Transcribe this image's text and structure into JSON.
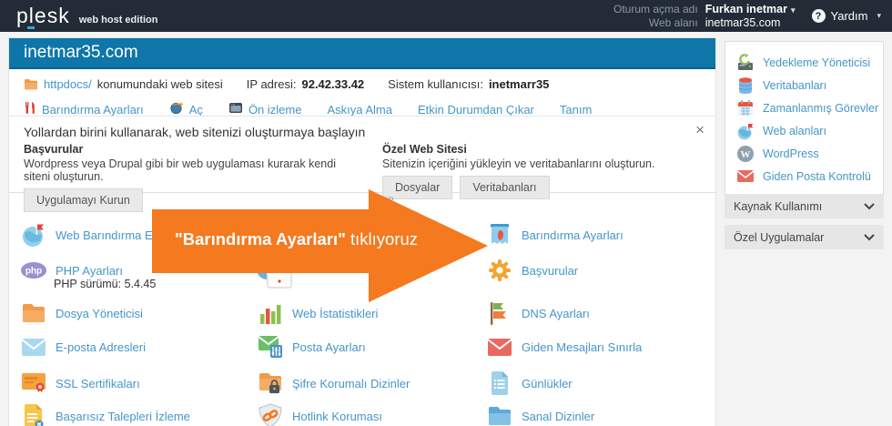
{
  "topbar": {
    "logo": "plesk",
    "edition": "web host edition",
    "session_label": "Oturum açma adı",
    "session_value": "Furkan inetmar",
    "webspace_label": "Web alanı",
    "webspace_value": "inetmar35.com",
    "help_label": "Yardım"
  },
  "icons": {
    "caret": "▾",
    "close": "×",
    "help": "?"
  },
  "header": {
    "title": "inetmar35.com",
    "location_link": "httpdocs/",
    "location_text": "konumundaki web sitesi",
    "ip_label": "IP adresi:",
    "ip_value": "92.42.33.42",
    "sysuser_label": "Sistem kullanıcısı:",
    "sysuser_value": "inetmarr35"
  },
  "toolbar": {
    "items": [
      {
        "label": "Barındırma Ayarları"
      },
      {
        "label": "Aç"
      },
      {
        "label": "Ön izleme"
      },
      {
        "label": "Askıya Alma"
      },
      {
        "label": "Etkin Durumdan Çıkar"
      },
      {
        "label": "Tanım"
      }
    ]
  },
  "promo": {
    "title": "Yollardan birini kullanarak, web sitenizi oluşturmaya başlayın",
    "apps": {
      "title": "Başvurular",
      "desc": "Wordpress veya Drupal gibi bir web uygulaması kurarak kendi siteni oluşturun.",
      "button": "Uygulamayı Kurun"
    },
    "custom": {
      "title": "Özel Web Sitesi",
      "desc": "Sitenizin içeriğini yükleyin ve veritabanlarını oluşturun.",
      "button_files": "Dosyalar",
      "button_db": "Veritabanları"
    }
  },
  "grid": {
    "col1": [
      {
        "label": "Web Barındırma Erişimi"
      },
      {
        "label": "PHP Ayarları",
        "sublabel": "PHP sürümü: 5.4.45"
      },
      {
        "label": "Dosya Yöneticisi"
      },
      {
        "label": "E-posta Adresleri"
      },
      {
        "label": "SSL Sertifikaları"
      },
      {
        "label": "Başarısız Talepleri İzleme"
      }
    ],
    "col2": [
      {
        "label": "Web İstatistikleri"
      },
      {
        "label": "Posta Ayarları"
      },
      {
        "label": "Şifre Korumalı Dizinler"
      },
      {
        "label": "Hotlink Koruması"
      }
    ],
    "col3": [
      {
        "label": "Barındırma Ayarları"
      },
      {
        "label": "Başvurular"
      },
      {
        "label": "DNS Ayarları"
      },
      {
        "label": "Giden Mesajları Sınırla"
      },
      {
        "label": "Günlükler"
      },
      {
        "label": "Sanal Dizinler"
      }
    ]
  },
  "annotation": {
    "quoted": "\"Barındırma Ayarları\"",
    "action": "tıklıyoruz",
    "covered_fragment": "TER"
  },
  "sidebar": {
    "items": [
      {
        "label": "Yedekleme Yöneticisi"
      },
      {
        "label": "Veritabanları"
      },
      {
        "label": "Zamanlanmış Görevler"
      },
      {
        "label": "Web alanları"
      },
      {
        "label": "WordPress"
      },
      {
        "label": "Giden Posta Kontrolü"
      }
    ],
    "panels": [
      {
        "label": "Kaynak Kullanımı"
      },
      {
        "label": "Özel Uygulamalar"
      }
    ]
  },
  "colors": {
    "topbar_dark": "#222b36",
    "header_blue": "#0e76a8",
    "link_blue": "#4596c8",
    "arrow_orange": "#f4791f"
  }
}
